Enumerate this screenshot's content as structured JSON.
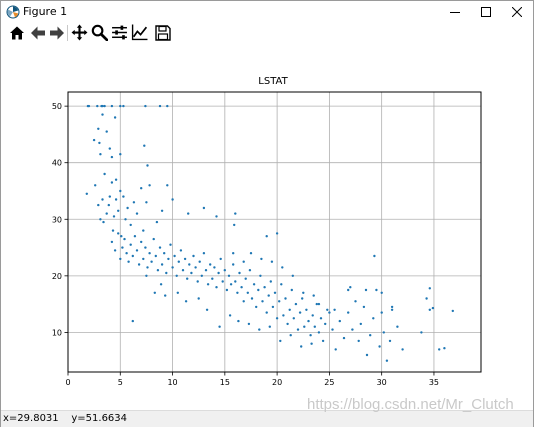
{
  "window": {
    "title": "Figure 1",
    "controls": [
      "minimize",
      "maximize",
      "close"
    ]
  },
  "toolbar": {
    "buttons": [
      {
        "name": "home-icon",
        "tooltip": "Home"
      },
      {
        "name": "back-icon",
        "tooltip": "Back"
      },
      {
        "name": "forward-icon",
        "tooltip": "Forward"
      },
      {
        "name": "pan-icon",
        "tooltip": "Pan"
      },
      {
        "name": "zoom-icon",
        "tooltip": "Zoom"
      },
      {
        "name": "subplots-icon",
        "tooltip": "Subplots"
      },
      {
        "name": "edit-axes-icon",
        "tooltip": "Customize"
      },
      {
        "name": "save-icon",
        "tooltip": "Save"
      }
    ]
  },
  "status": {
    "coords": "x=29.8031    y=51.6634"
  },
  "watermark": "https://blog.csdn.net/Mr_Clutch",
  "colors": {
    "marker": "#1f77b4",
    "grid": "#b0b0b0"
  },
  "chart_data": {
    "type": "scatter",
    "title": "LSTAT",
    "xlabel": "",
    "ylabel": "",
    "xlim": [
      0,
      39.5
    ],
    "ylim": [
      3,
      52.5
    ],
    "xticks": [
      0,
      5,
      10,
      15,
      20,
      25,
      30,
      35
    ],
    "yticks": [
      10,
      20,
      30,
      40,
      50
    ],
    "grid": true,
    "points": [
      [
        1.9,
        50
      ],
      [
        2.0,
        50
      ],
      [
        2.8,
        50
      ],
      [
        3.2,
        50
      ],
      [
        3.3,
        50
      ],
      [
        3.5,
        50
      ],
      [
        4.2,
        50
      ],
      [
        5.0,
        50
      ],
      [
        5.3,
        50
      ],
      [
        7.4,
        50
      ],
      [
        8.8,
        50
      ],
      [
        9.5,
        50
      ],
      [
        2.5,
        44.0
      ],
      [
        2.9,
        46.0
      ],
      [
        3.0,
        43.5
      ],
      [
        3.1,
        41.5
      ],
      [
        3.3,
        48.5
      ],
      [
        3.5,
        38.0
      ],
      [
        3.7,
        45.5
      ],
      [
        4.0,
        42.5
      ],
      [
        4.2,
        41.0
      ],
      [
        4.5,
        48.0
      ],
      [
        4.6,
        37.0
      ],
      [
        5.0,
        41.5
      ],
      [
        7.3,
        43.0
      ],
      [
        7.6,
        39.5
      ],
      [
        1.8,
        34.5
      ],
      [
        2.6,
        36.0
      ],
      [
        2.9,
        32.5
      ],
      [
        3.1,
        30.0
      ],
      [
        3.3,
        33.5
      ],
      [
        3.4,
        29.5
      ],
      [
        3.7,
        31.0
      ],
      [
        3.9,
        32.5
      ],
      [
        4.0,
        34.0
      ],
      [
        4.2,
        36.5
      ],
      [
        4.3,
        28.0
      ],
      [
        4.4,
        30.5
      ],
      [
        4.6,
        33.5
      ],
      [
        4.8,
        31.5
      ],
      [
        5.0,
        35.0
      ],
      [
        5.1,
        27.0
      ],
      [
        5.3,
        34.0
      ],
      [
        5.5,
        30.0
      ],
      [
        5.7,
        32.0
      ],
      [
        6.0,
        29.0
      ],
      [
        6.3,
        33.0
      ],
      [
        6.6,
        31.0
      ],
      [
        7.0,
        35.5
      ],
      [
        7.2,
        28.0
      ],
      [
        7.5,
        33.0
      ],
      [
        7.8,
        36.0
      ],
      [
        8.5,
        29.5
      ],
      [
        9.0,
        31.5
      ],
      [
        9.5,
        36.0
      ],
      [
        10.0,
        33.5
      ],
      [
        11.5,
        31.0
      ],
      [
        13.0,
        32.0
      ],
      [
        14.2,
        30.5
      ],
      [
        16.0,
        31.0
      ],
      [
        15.9,
        29.0
      ],
      [
        4.2,
        26.0
      ],
      [
        4.5,
        24.5
      ],
      [
        4.8,
        27.5
      ],
      [
        5.0,
        23.0
      ],
      [
        5.2,
        25.0
      ],
      [
        5.4,
        26.5
      ],
      [
        5.6,
        24.0
      ],
      [
        5.8,
        22.5
      ],
      [
        6.0,
        25.5
      ],
      [
        6.2,
        23.5
      ],
      [
        6.4,
        27.0
      ],
      [
        6.6,
        24.5
      ],
      [
        6.8,
        22.0
      ],
      [
        7.0,
        26.0
      ],
      [
        7.2,
        23.0
      ],
      [
        7.4,
        25.0
      ],
      [
        7.6,
        21.5
      ],
      [
        7.8,
        24.0
      ],
      [
        8.0,
        22.5
      ],
      [
        8.2,
        26.5
      ],
      [
        8.4,
        23.5
      ],
      [
        8.6,
        21.0
      ],
      [
        8.8,
        25.0
      ],
      [
        9.0,
        22.0
      ],
      [
        9.2,
        24.0
      ],
      [
        9.4,
        20.5
      ],
      [
        9.6,
        23.0
      ],
      [
        9.8,
        25.5
      ],
      [
        10.0,
        21.5
      ],
      [
        10.2,
        23.5
      ],
      [
        10.4,
        20.0
      ],
      [
        10.6,
        22.5
      ],
      [
        10.8,
        24.5
      ],
      [
        11.0,
        21.0
      ],
      [
        11.2,
        23.0
      ],
      [
        11.4,
        19.5
      ],
      [
        11.6,
        22.0
      ],
      [
        11.8,
        20.5
      ],
      [
        12.0,
        23.5
      ],
      [
        12.2,
        21.5
      ],
      [
        12.4,
        19.0
      ],
      [
        12.6,
        22.5
      ],
      [
        12.8,
        20.0
      ],
      [
        13.0,
        24.0
      ],
      [
        13.2,
        21.0
      ],
      [
        13.4,
        18.5
      ],
      [
        13.6,
        22.0
      ],
      [
        13.8,
        19.5
      ],
      [
        14.0,
        21.5
      ],
      [
        14.2,
        18.0
      ],
      [
        14.4,
        20.5
      ],
      [
        14.6,
        23.0
      ],
      [
        14.8,
        19.0
      ],
      [
        15.0,
        21.0
      ],
      [
        15.2,
        17.5
      ],
      [
        15.4,
        20.0
      ],
      [
        15.6,
        18.5
      ],
      [
        15.8,
        22.0
      ],
      [
        16.0,
        19.0
      ],
      [
        16.2,
        17.0
      ],
      [
        16.4,
        20.5
      ],
      [
        16.6,
        18.0
      ],
      [
        16.8,
        15.5
      ],
      [
        17.0,
        19.5
      ],
      [
        17.2,
        17.0
      ],
      [
        17.4,
        21.0
      ],
      [
        17.6,
        16.0
      ],
      [
        17.8,
        18.5
      ],
      [
        18.0,
        14.5
      ],
      [
        18.2,
        17.5
      ],
      [
        18.4,
        20.0
      ],
      [
        18.6,
        15.5
      ],
      [
        18.8,
        18.0
      ],
      [
        19.0,
        13.5
      ],
      [
        19.2,
        16.5
      ],
      [
        19.4,
        19.0
      ],
      [
        19.6,
        14.5
      ],
      [
        19.8,
        17.0
      ],
      [
        20.0,
        12.5
      ],
      [
        20.2,
        15.5
      ],
      [
        20.4,
        18.5
      ],
      [
        20.6,
        13.0
      ],
      [
        20.8,
        16.0
      ],
      [
        21.0,
        11.5
      ],
      [
        21.2,
        14.0
      ],
      [
        21.4,
        17.5
      ],
      [
        21.6,
        12.5
      ],
      [
        21.8,
        15.0
      ],
      [
        22.0,
        10.5
      ],
      [
        22.2,
        13.5
      ],
      [
        22.4,
        16.0
      ],
      [
        22.6,
        11.0
      ],
      [
        22.8,
        14.0
      ],
      [
        23.0,
        12.0
      ],
      [
        23.2,
        9.5
      ],
      [
        23.4,
        13.0
      ],
      [
        23.6,
        11.0
      ],
      [
        23.8,
        15.0
      ],
      [
        24.0,
        10.0
      ],
      [
        24.2,
        12.5
      ],
      [
        24.4,
        8.5
      ],
      [
        24.6,
        11.5
      ],
      [
        24.8,
        14.0
      ],
      [
        6.2,
        12.0
      ],
      [
        7.5,
        20.0
      ],
      [
        8.3,
        17.0
      ],
      [
        8.9,
        18.5
      ],
      [
        9.3,
        16.5
      ],
      [
        10.5,
        17.0
      ],
      [
        11.3,
        15.5
      ],
      [
        12.5,
        16.0
      ],
      [
        13.3,
        14.0
      ],
      [
        14.5,
        11.0
      ],
      [
        15.5,
        13.0
      ],
      [
        16.3,
        12.0
      ],
      [
        17.3,
        11.5
      ],
      [
        18.3,
        10.5
      ],
      [
        19.3,
        11.0
      ],
      [
        20.3,
        8.5
      ],
      [
        21.3,
        9.5
      ],
      [
        22.3,
        7.5
      ],
      [
        23.3,
        8.0
      ],
      [
        25.0,
        13.5
      ],
      [
        25.3,
        10.5
      ],
      [
        25.6,
        7.0
      ],
      [
        26.0,
        12.0
      ],
      [
        26.4,
        9.0
      ],
      [
        26.8,
        13.5
      ],
      [
        27.2,
        10.5
      ],
      [
        27.5,
        15.5
      ],
      [
        27.8,
        8.5
      ],
      [
        28.0,
        11.5
      ],
      [
        28.3,
        14.5
      ],
      [
        28.6,
        6.0
      ],
      [
        28.9,
        9.5
      ],
      [
        29.2,
        12.5
      ],
      [
        29.5,
        17.5
      ],
      [
        29.8,
        7.5
      ],
      [
        30.0,
        13.5
      ],
      [
        30.2,
        10.0
      ],
      [
        30.5,
        5.0
      ],
      [
        30.8,
        8.5
      ],
      [
        31.0,
        14.0
      ],
      [
        31.5,
        11.0
      ],
      [
        32.0,
        7.0
      ],
      [
        33.8,
        10.0
      ],
      [
        34.3,
        16.0
      ],
      [
        34.6,
        14.0
      ],
      [
        34.9,
        14.3
      ],
      [
        35.5,
        7.0
      ],
      [
        36.8,
        13.8
      ],
      [
        34.6,
        17.8
      ],
      [
        36.0,
        7.2
      ],
      [
        29.3,
        23.5
      ],
      [
        27.0,
        18.0
      ],
      [
        28.5,
        17.5
      ],
      [
        30.0,
        17.0
      ],
      [
        31.0,
        14.5
      ],
      [
        26.8,
        17.5
      ],
      [
        25.5,
        14.0
      ],
      [
        24.0,
        15.0
      ],
      [
        23.5,
        16.5
      ],
      [
        22.5,
        17.0
      ],
      [
        21.5,
        20.0
      ],
      [
        20.5,
        21.5
      ],
      [
        19.5,
        22.5
      ],
      [
        19.0,
        27.0
      ],
      [
        20.0,
        27.5
      ],
      [
        18.5,
        23.0
      ],
      [
        17.5,
        24.0
      ],
      [
        16.8,
        22.5
      ],
      [
        15.8,
        24.0
      ]
    ]
  }
}
